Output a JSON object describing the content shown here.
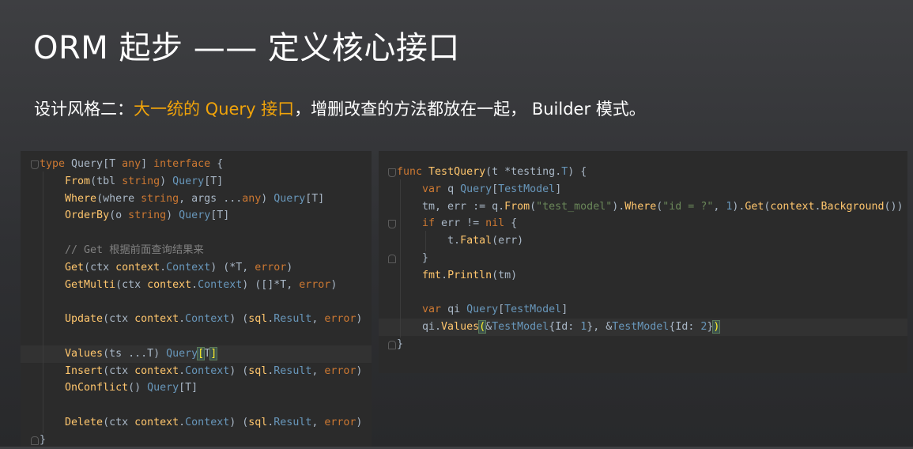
{
  "slide": {
    "title": "ORM 起步 —— 定义核心接口",
    "subtitle_prefix": "设计风格二：",
    "subtitle_highlight": "大一统的 Query 接口",
    "subtitle_suffix": "，增删改查的方法都放在一起， Builder 模式。"
  },
  "colors": {
    "title_text": "#ffffff",
    "highlight": "#f0a30a",
    "editor_bg": "#2b2b2b",
    "keyword": "#cc7832",
    "function": "#ffc66d",
    "type": "#6897bb",
    "string": "#6a8759",
    "comment": "#808080"
  },
  "left_code": [
    [
      [
        "kw",
        "type"
      ],
      [
        "pl",
        " Query[T "
      ],
      [
        "kw",
        "any"
      ],
      [
        "pl",
        "] "
      ],
      [
        "kw",
        "interface"
      ],
      [
        "pl",
        " {"
      ]
    ],
    [
      [
        "pl",
        "    "
      ],
      [
        "fn",
        "From"
      ],
      [
        "pl",
        "(tbl "
      ],
      [
        "kw",
        "string"
      ],
      [
        "pl",
        ") "
      ],
      [
        "ty",
        "Query"
      ],
      [
        "pl",
        "[T]"
      ]
    ],
    [
      [
        "pl",
        "    "
      ],
      [
        "fn",
        "Where"
      ],
      [
        "pl",
        "(where "
      ],
      [
        "kw",
        "string"
      ],
      [
        "pl",
        ", args ..."
      ],
      [
        "kw",
        "any"
      ],
      [
        "pl",
        ") "
      ],
      [
        "ty",
        "Query"
      ],
      [
        "pl",
        "[T]"
      ]
    ],
    [
      [
        "pl",
        "    "
      ],
      [
        "fn",
        "OrderBy"
      ],
      [
        "pl",
        "(o "
      ],
      [
        "kw",
        "string"
      ],
      [
        "pl",
        ") "
      ],
      [
        "ty",
        "Query"
      ],
      [
        "pl",
        "[T]"
      ]
    ],
    [],
    [
      [
        "pl",
        "    "
      ],
      [
        "cm",
        "// Get 根据前面查询结果来"
      ]
    ],
    [
      [
        "pl",
        "    "
      ],
      [
        "fn",
        "Get"
      ],
      [
        "pl",
        "(ctx "
      ],
      [
        "fn",
        "context"
      ],
      [
        "pl",
        "."
      ],
      [
        "ty",
        "Context"
      ],
      [
        "pl",
        ") (*T, "
      ],
      [
        "kw",
        "error"
      ],
      [
        "pl",
        ")"
      ]
    ],
    [
      [
        "pl",
        "    "
      ],
      [
        "fn",
        "GetMulti"
      ],
      [
        "pl",
        "(ctx "
      ],
      [
        "fn",
        "context"
      ],
      [
        "pl",
        "."
      ],
      [
        "ty",
        "Context"
      ],
      [
        "pl",
        ") ([]*T, "
      ],
      [
        "kw",
        "error"
      ],
      [
        "pl",
        ")"
      ]
    ],
    [],
    [
      [
        "pl",
        "    "
      ],
      [
        "fn",
        "Update"
      ],
      [
        "pl",
        "(ctx "
      ],
      [
        "fn",
        "context"
      ],
      [
        "pl",
        "."
      ],
      [
        "ty",
        "Context"
      ],
      [
        "pl",
        ") ("
      ],
      [
        "fn",
        "sql"
      ],
      [
        "pl",
        "."
      ],
      [
        "ty",
        "Result"
      ],
      [
        "pl",
        ", "
      ],
      [
        "kw",
        "error"
      ],
      [
        "pl",
        ")"
      ]
    ],
    [],
    [
      [
        "pl",
        "    "
      ],
      [
        "fn",
        "Values"
      ],
      [
        "pl",
        "(ts ...T) "
      ],
      [
        "ty",
        "Query"
      ],
      [
        "bh",
        "["
      ],
      [
        "pl",
        "T"
      ],
      [
        "bh",
        "]"
      ]
    ],
    [
      [
        "pl",
        "    "
      ],
      [
        "fn",
        "Insert"
      ],
      [
        "pl",
        "(ctx "
      ],
      [
        "fn",
        "context"
      ],
      [
        "pl",
        "."
      ],
      [
        "ty",
        "Context"
      ],
      [
        "pl",
        ") ("
      ],
      [
        "fn",
        "sql"
      ],
      [
        "pl",
        "."
      ],
      [
        "ty",
        "Result"
      ],
      [
        "pl",
        ", "
      ],
      [
        "kw",
        "error"
      ],
      [
        "pl",
        ")"
      ]
    ],
    [
      [
        "pl",
        "    "
      ],
      [
        "fn",
        "OnConflict"
      ],
      [
        "pl",
        "() "
      ],
      [
        "ty",
        "Query"
      ],
      [
        "pl",
        "[T]"
      ]
    ],
    [],
    [
      [
        "pl",
        "    "
      ],
      [
        "fn",
        "Delete"
      ],
      [
        "pl",
        "(ctx "
      ],
      [
        "fn",
        "context"
      ],
      [
        "pl",
        "."
      ],
      [
        "ty",
        "Context"
      ],
      [
        "pl",
        ") ("
      ],
      [
        "fn",
        "sql"
      ],
      [
        "pl",
        "."
      ],
      [
        "ty",
        "Result"
      ],
      [
        "pl",
        ", "
      ],
      [
        "kw",
        "error"
      ],
      [
        "pl",
        ")"
      ]
    ],
    [
      [
        "pl",
        "}"
      ]
    ]
  ],
  "right_code": [
    [
      [
        "kw",
        "func"
      ],
      [
        "pl",
        " "
      ],
      [
        "fn",
        "TestQuery"
      ],
      [
        "pl",
        "(t *"
      ],
      [
        "pl",
        "testing"
      ],
      [
        "pl",
        "."
      ],
      [
        "ty",
        "T"
      ],
      [
        "pl",
        ") {"
      ]
    ],
    [
      [
        "pl",
        "    "
      ],
      [
        "kw",
        "var"
      ],
      [
        "pl",
        " q "
      ],
      [
        "ty",
        "Query"
      ],
      [
        "pl",
        "["
      ],
      [
        "ty",
        "TestModel"
      ],
      [
        "pl",
        "]"
      ]
    ],
    [
      [
        "pl",
        "    tm, err := q."
      ],
      [
        "fn",
        "From"
      ],
      [
        "pl",
        "("
      ],
      [
        "st",
        "\"test_model\""
      ],
      [
        "pl",
        ")."
      ],
      [
        "fn",
        "Where"
      ],
      [
        "pl",
        "("
      ],
      [
        "st",
        "\"id = ?\""
      ],
      [
        "pl",
        ", "
      ],
      [
        "nm",
        "1"
      ],
      [
        "pl",
        ")."
      ],
      [
        "fn",
        "Get"
      ],
      [
        "pl",
        "("
      ],
      [
        "fn",
        "context"
      ],
      [
        "pl",
        "."
      ],
      [
        "fn",
        "Background"
      ],
      [
        "pl",
        "())"
      ]
    ],
    [
      [
        "pl",
        "    "
      ],
      [
        "kw",
        "if"
      ],
      [
        "pl",
        " err != "
      ],
      [
        "kw",
        "nil"
      ],
      [
        "pl",
        " {"
      ]
    ],
    [
      [
        "pl",
        "        t."
      ],
      [
        "fn",
        "Fatal"
      ],
      [
        "pl",
        "(err)"
      ]
    ],
    [
      [
        "pl",
        "    }"
      ]
    ],
    [
      [
        "pl",
        "    "
      ],
      [
        "fn",
        "fmt"
      ],
      [
        "pl",
        "."
      ],
      [
        "fn",
        "Println"
      ],
      [
        "pl",
        "(tm)"
      ]
    ],
    [],
    [
      [
        "pl",
        "    "
      ],
      [
        "kw",
        "var"
      ],
      [
        "pl",
        " qi "
      ],
      [
        "ty",
        "Query"
      ],
      [
        "pl",
        "["
      ],
      [
        "ty",
        "TestModel"
      ],
      [
        "pl",
        "]"
      ]
    ],
    [
      [
        "pl",
        "    qi."
      ],
      [
        "fn",
        "Values"
      ],
      [
        "bh",
        "("
      ],
      [
        "pl",
        "&"
      ],
      [
        "ty",
        "TestModel"
      ],
      [
        "pl",
        "{Id: "
      ],
      [
        "nm",
        "1"
      ],
      [
        "pl",
        "}, &"
      ],
      [
        "ty",
        "TestModel"
      ],
      [
        "pl",
        "{Id: "
      ],
      [
        "nm",
        "2"
      ],
      [
        "pl",
        "}"
      ],
      [
        "bh",
        ")"
      ]
    ],
    [
      [
        "pl",
        "}"
      ]
    ]
  ]
}
